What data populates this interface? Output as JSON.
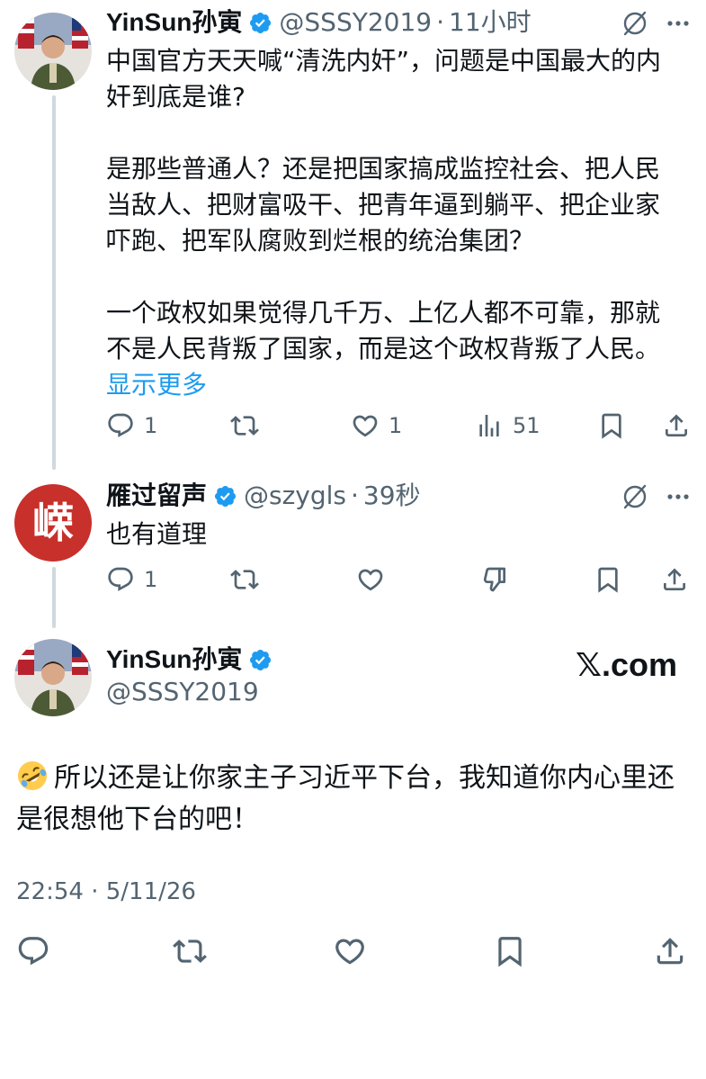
{
  "thread": {
    "tweet1": {
      "display_name": "YinSun孙寅",
      "handle": "@SSSY2019",
      "separator": "·",
      "time": "11小时",
      "paragraphs": [
        "中国官方天天喊“清洗内奸”，问题是中国最大的内奸到底是谁?",
        "是那些普通人？还是把国家搞成监控社会、把人民当敌人、把财富吸干、把青年逼到躺平、把企业家吓跑、把军队腐败到烂根的统治集团？",
        "一个政权如果觉得几千万、上亿人都不可靠，那就不是人民背叛了国家，而是这个政权背叛了人民。"
      ],
      "show_more": "显示更多",
      "actions": {
        "replies": "1",
        "retweets": "",
        "likes": "1",
        "views": "51"
      },
      "icons": [
        "avatar-soldier",
        "verified-badge",
        "grok-slash-icon",
        "more-icon",
        "reply-icon",
        "retweet-icon",
        "like-icon",
        "views-icon",
        "bookmark-icon",
        "share-icon"
      ]
    },
    "tweet2": {
      "display_name": "雁过留声",
      "handle": "@szygls",
      "separator": "·",
      "time": "39秒",
      "text": "也有道理",
      "avatar_glyph": "嵘",
      "actions": {
        "replies": "1",
        "retweets": "",
        "likes": ""
      },
      "icons": [
        "grok-slash-icon",
        "more-icon",
        "reply-icon",
        "retweet-icon",
        "like-icon",
        "dislike-icon",
        "bookmark-icon",
        "share-icon"
      ]
    }
  },
  "main_tweet": {
    "display_name": "YinSun孙寅",
    "handle": "@SSSY2019",
    "brand": "𝕏.com",
    "emoji": "rolling-on-floor-laughing",
    "text": "所以还是让你家主子习近平下台，我知道你内心里还是很想他下台的吧！",
    "timestamp": "22:54 · 5/11/26"
  },
  "colors": {
    "text": "#0f1419",
    "secondary": "#536471",
    "link": "#1d9bf0",
    "verified": "#1d9bf0",
    "thread_line": "#cfd9de",
    "avatar2_bg": "#c8302b"
  }
}
